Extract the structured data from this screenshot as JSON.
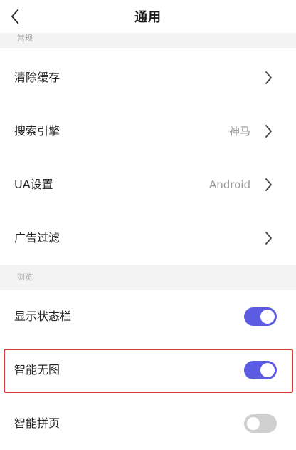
{
  "header": {
    "title": "通用",
    "back_icon": "chevron-left-icon"
  },
  "sections": {
    "general": {
      "label": "常规"
    },
    "browse": {
      "label": "浏览"
    }
  },
  "rows": {
    "clear_cache": {
      "label": "清除缓存",
      "icon": "chevron-right-icon"
    },
    "search_engine": {
      "label": "搜索引擎",
      "value": "神马",
      "icon": "chevron-right-icon"
    },
    "ua_settings": {
      "label": "UA设置",
      "value": "Android",
      "icon": "chevron-right-icon"
    },
    "ad_filter": {
      "label": "广告过滤",
      "icon": "chevron-right-icon"
    },
    "show_status_bar": {
      "label": "显示状态栏",
      "toggle": true
    },
    "smart_no_image": {
      "label": "智能无图",
      "toggle": true
    },
    "smart_page_join": {
      "label": "智能拼页",
      "toggle": false
    }
  },
  "colors": {
    "toggle_on": "#5b5ce2",
    "toggle_off": "#cfcfcf",
    "highlight": "#d63a3a",
    "section_bg": "#f3f3f3"
  }
}
